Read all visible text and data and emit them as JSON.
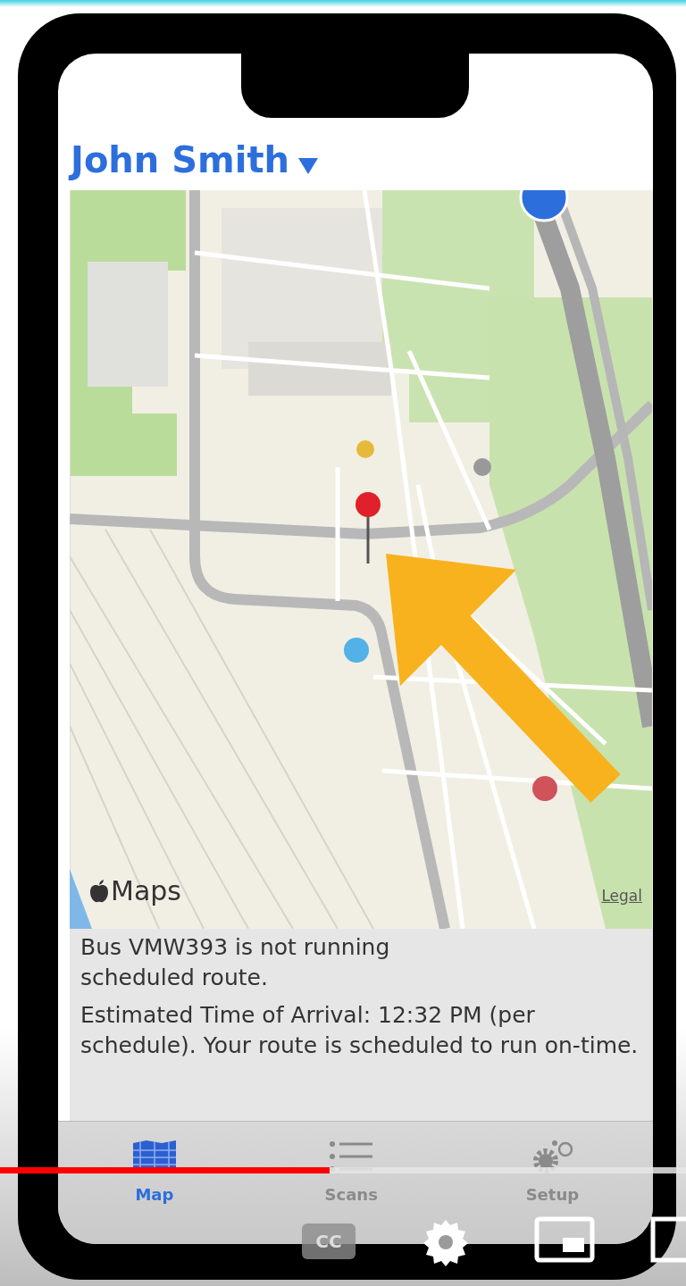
{
  "header": {
    "user_name": "John Smith"
  },
  "map": {
    "attribution": "Maps",
    "legal_link": "Legal"
  },
  "messages": [
    "Bus VMW393 is not running scheduled route.",
    "Estimated Time of Arrival: 12:32 PM (per schedule). Your route is scheduled to run on-time."
  ],
  "tabs": [
    {
      "label": "Map",
      "kind": "map",
      "selected": true
    },
    {
      "label": "Scans",
      "kind": "list",
      "selected": false
    },
    {
      "label": "Setup",
      "kind": "setup",
      "selected": false
    }
  ],
  "video_player": {
    "progress": {
      "level": 0.48
    },
    "captions_label": "CC"
  }
}
